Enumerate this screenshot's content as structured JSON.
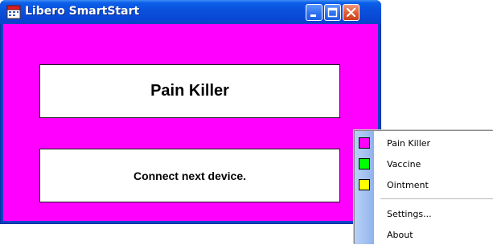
{
  "window": {
    "title": "Libero SmartStart",
    "title_bar_color": "#0a50dc",
    "buttons": [
      "minimize",
      "maximize",
      "close"
    ]
  },
  "client": {
    "background": "#ff00ff",
    "product_name": "Pain Killer",
    "status_message": "Connect next device."
  },
  "context_menu": {
    "items": [
      {
        "label": "Pain Killer",
        "swatch": "#ff00ff"
      },
      {
        "label": "Vaccine",
        "swatch": "#00ff00"
      },
      {
        "label": "Ointment",
        "swatch": "#ffff00"
      }
    ],
    "actions": [
      {
        "label": "Settings..."
      },
      {
        "label": "About"
      }
    ]
  }
}
